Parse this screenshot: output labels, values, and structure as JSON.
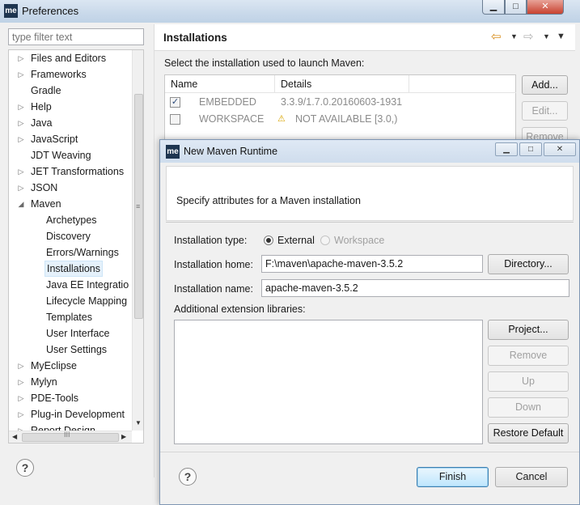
{
  "window": {
    "app_icon": "me",
    "title": "Preferences",
    "controls": {
      "minimize": "▁",
      "maximize": "□",
      "close": "✕"
    }
  },
  "filter": {
    "placeholder": "type filter text"
  },
  "tree": {
    "items": [
      {
        "label": "Files and Editors",
        "twisty": "▷",
        "indent": 0
      },
      {
        "label": "Frameworks",
        "twisty": "▷",
        "indent": 0
      },
      {
        "label": "Gradle",
        "twisty": "",
        "indent": 0
      },
      {
        "label": "Help",
        "twisty": "▷",
        "indent": 0
      },
      {
        "label": "Java",
        "twisty": "▷",
        "indent": 0
      },
      {
        "label": "JavaScript",
        "twisty": "▷",
        "indent": 0
      },
      {
        "label": "JDT Weaving",
        "twisty": "",
        "indent": 0
      },
      {
        "label": "JET Transformations",
        "twisty": "▷",
        "indent": 0
      },
      {
        "label": "JSON",
        "twisty": "▷",
        "indent": 0
      },
      {
        "label": "Maven",
        "twisty": "◢",
        "indent": 0
      },
      {
        "label": "Archetypes",
        "twisty": "",
        "indent": 1
      },
      {
        "label": "Discovery",
        "twisty": "",
        "indent": 1
      },
      {
        "label": "Errors/Warnings",
        "twisty": "",
        "indent": 1
      },
      {
        "label": "Installations",
        "twisty": "",
        "indent": 1,
        "selected": true
      },
      {
        "label": "Java EE Integratio",
        "twisty": "",
        "indent": 1
      },
      {
        "label": "Lifecycle Mapping",
        "twisty": "",
        "indent": 1
      },
      {
        "label": "Templates",
        "twisty": "",
        "indent": 1
      },
      {
        "label": "User Interface",
        "twisty": "",
        "indent": 1
      },
      {
        "label": "User Settings",
        "twisty": "",
        "indent": 1
      },
      {
        "label": "MyEclipse",
        "twisty": "▷",
        "indent": 0
      },
      {
        "label": "Mylyn",
        "twisty": "▷",
        "indent": 0
      },
      {
        "label": "PDE-Tools",
        "twisty": "▷",
        "indent": 0
      },
      {
        "label": "Plug-in Development",
        "twisty": "▷",
        "indent": 0
      },
      {
        "label": "Report Design",
        "twisty": "▷",
        "indent": 0
      }
    ],
    "scroll_grip": "≡",
    "hscroll_grip": "III"
  },
  "pane": {
    "title": "Installations",
    "description": "Select the installation used to launch Maven:",
    "table": {
      "headers": [
        "Name",
        "Details"
      ],
      "rows": [
        {
          "checked": true,
          "name": "EMBEDDED",
          "details": "3.3.9/1.7.0.20160603-1931"
        },
        {
          "checked": false,
          "name": "WORKSPACE",
          "details": "NOT AVAILABLE [3.0,)",
          "warning": true
        }
      ]
    },
    "buttons": {
      "add": "Add...",
      "edit": "Edit...",
      "remove": "Remove"
    }
  },
  "dialog": {
    "app_icon": "me",
    "title": "New Maven Runtime",
    "controls": {
      "minimize": "▁",
      "maximize": "□",
      "close": "✕"
    },
    "message": "Specify attributes for a Maven installation",
    "installation_type_label": "Installation type:",
    "type_external": "External",
    "type_workspace": "Workspace",
    "home_label": "Installation home:",
    "home_value": "F:\\maven\\apache-maven-3.5.2",
    "directory_button": "Directory...",
    "name_label": "Installation name:",
    "name_value": "apache-maven-3.5.2",
    "libraries_label": "Additional extension libraries:",
    "buttons": {
      "project": "Project...",
      "remove": "Remove",
      "up": "Up",
      "down": "Down",
      "restore": "Restore Default",
      "finish": "Finish",
      "cancel": "Cancel"
    },
    "help": "?"
  },
  "help": "?"
}
